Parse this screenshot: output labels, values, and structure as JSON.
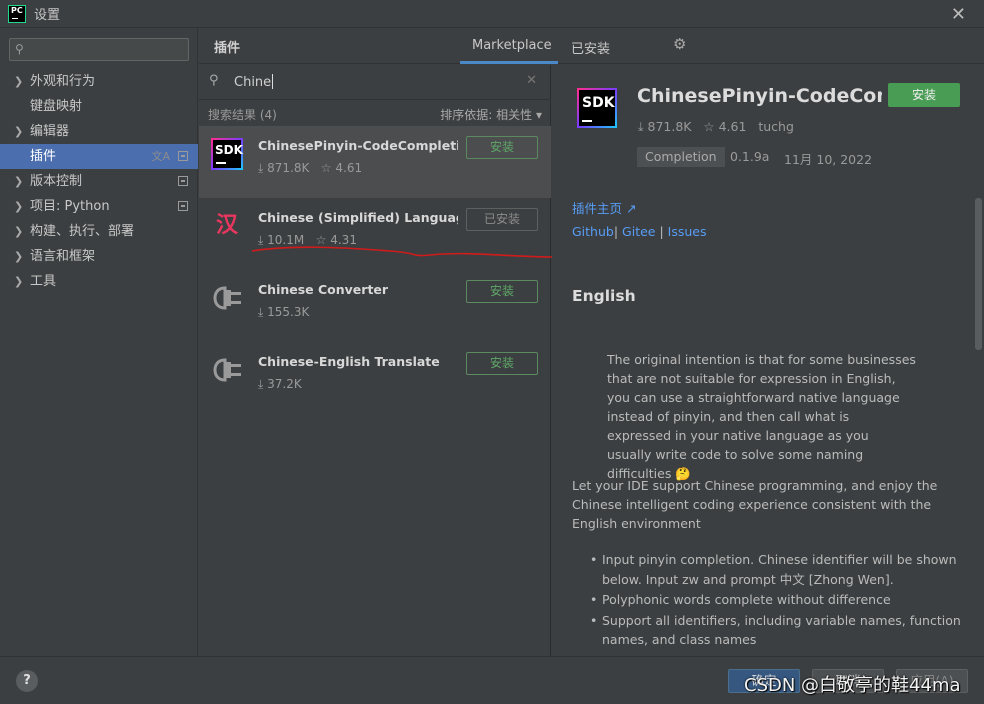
{
  "window": {
    "title": "设置",
    "logo": "PC",
    "close": "✕"
  },
  "sidebar": {
    "search_placeholder": "",
    "items": [
      {
        "label": "外观和行为",
        "expandable": true
      },
      {
        "label": "键盘映射",
        "expandable": false
      },
      {
        "label": "编辑器",
        "expandable": true
      },
      {
        "label": "插件",
        "expandable": false,
        "selected": true
      },
      {
        "label": "版本控制",
        "expandable": true
      },
      {
        "label": "项目: Python",
        "expandable": true
      },
      {
        "label": "构建、执行、部署",
        "expandable": true
      },
      {
        "label": "语言和框架",
        "expandable": true
      },
      {
        "label": "工具",
        "expandable": true
      }
    ]
  },
  "header": {
    "section_title": "插件",
    "tab_marketplace": "Marketplace",
    "tab_installed": "已安装",
    "settings_icon": "gear-icon"
  },
  "search": {
    "value": "Chine",
    "results_label": "搜索结果 (4)",
    "sort_label": "排序依据: 相关性 ▾"
  },
  "plugins": [
    {
      "name": "ChinesePinyin-CodeCompletio...",
      "downloads": "⤓ 871.8K",
      "rating": "☆ 4.61",
      "button": "安装",
      "icon": "sdk-icon",
      "icon_text": "SDK"
    },
    {
      "name": "Chinese (Simplified) Languag...",
      "downloads": "⤓ 10.1M",
      "rating": "☆ 4.31",
      "button": "已安装",
      "icon": "han-icon",
      "icon_text": "汉"
    },
    {
      "name": "Chinese Converter",
      "downloads": "⤓ 155.3K",
      "rating": "",
      "button": "安装",
      "icon": "plug-icon"
    },
    {
      "name": "Chinese-English Translate",
      "downloads": "⤓ 37.2K",
      "rating": "",
      "button": "安装",
      "icon": "plug-icon"
    }
  ],
  "detail": {
    "logo_text": "SDK",
    "name": "ChinesePinyin-CodeCompl",
    "install": "安装",
    "downloads": "⤓ 871.8K",
    "rating": "☆ 4.61",
    "author": "tuchg",
    "tag": "Completion",
    "version": "0.1.9a",
    "date": "11月 10, 2022",
    "homepage": "插件主页 ↗",
    "link_github": "Github",
    "link_gitee": "Gitee",
    "link_issues": "Issues",
    "heading": "English",
    "quote": "The original intention is that for some businesses that are not suitable for expression in English, you can use a straightforward native language instead of pinyin, and then call what is expressed in your native language as you usually write code to solve some naming difficulties 🤔",
    "paragraph": "Let your IDE support Chinese programming, and enjoy the Chinese intelligent coding experience consistent with the English environment",
    "bullets": [
      "Input pinyin completion. Chinese identifier will be shown below. Input zw and prompt 中文 [Zhong Wen].",
      "Polyphonic words complete without difference",
      "Support all identifiers, including variable names, function names, and class names"
    ]
  },
  "footer": {
    "help": "?",
    "ok": "确定",
    "cancel": "取消",
    "apply": "应用(A)",
    "watermark": "CSDN @白敬亭的鞋44ma"
  },
  "colors": {
    "accent": "#4b6eaf",
    "install_green": "#499c54",
    "link_blue": "#589df6",
    "annotation_red": "#d11b1b"
  }
}
